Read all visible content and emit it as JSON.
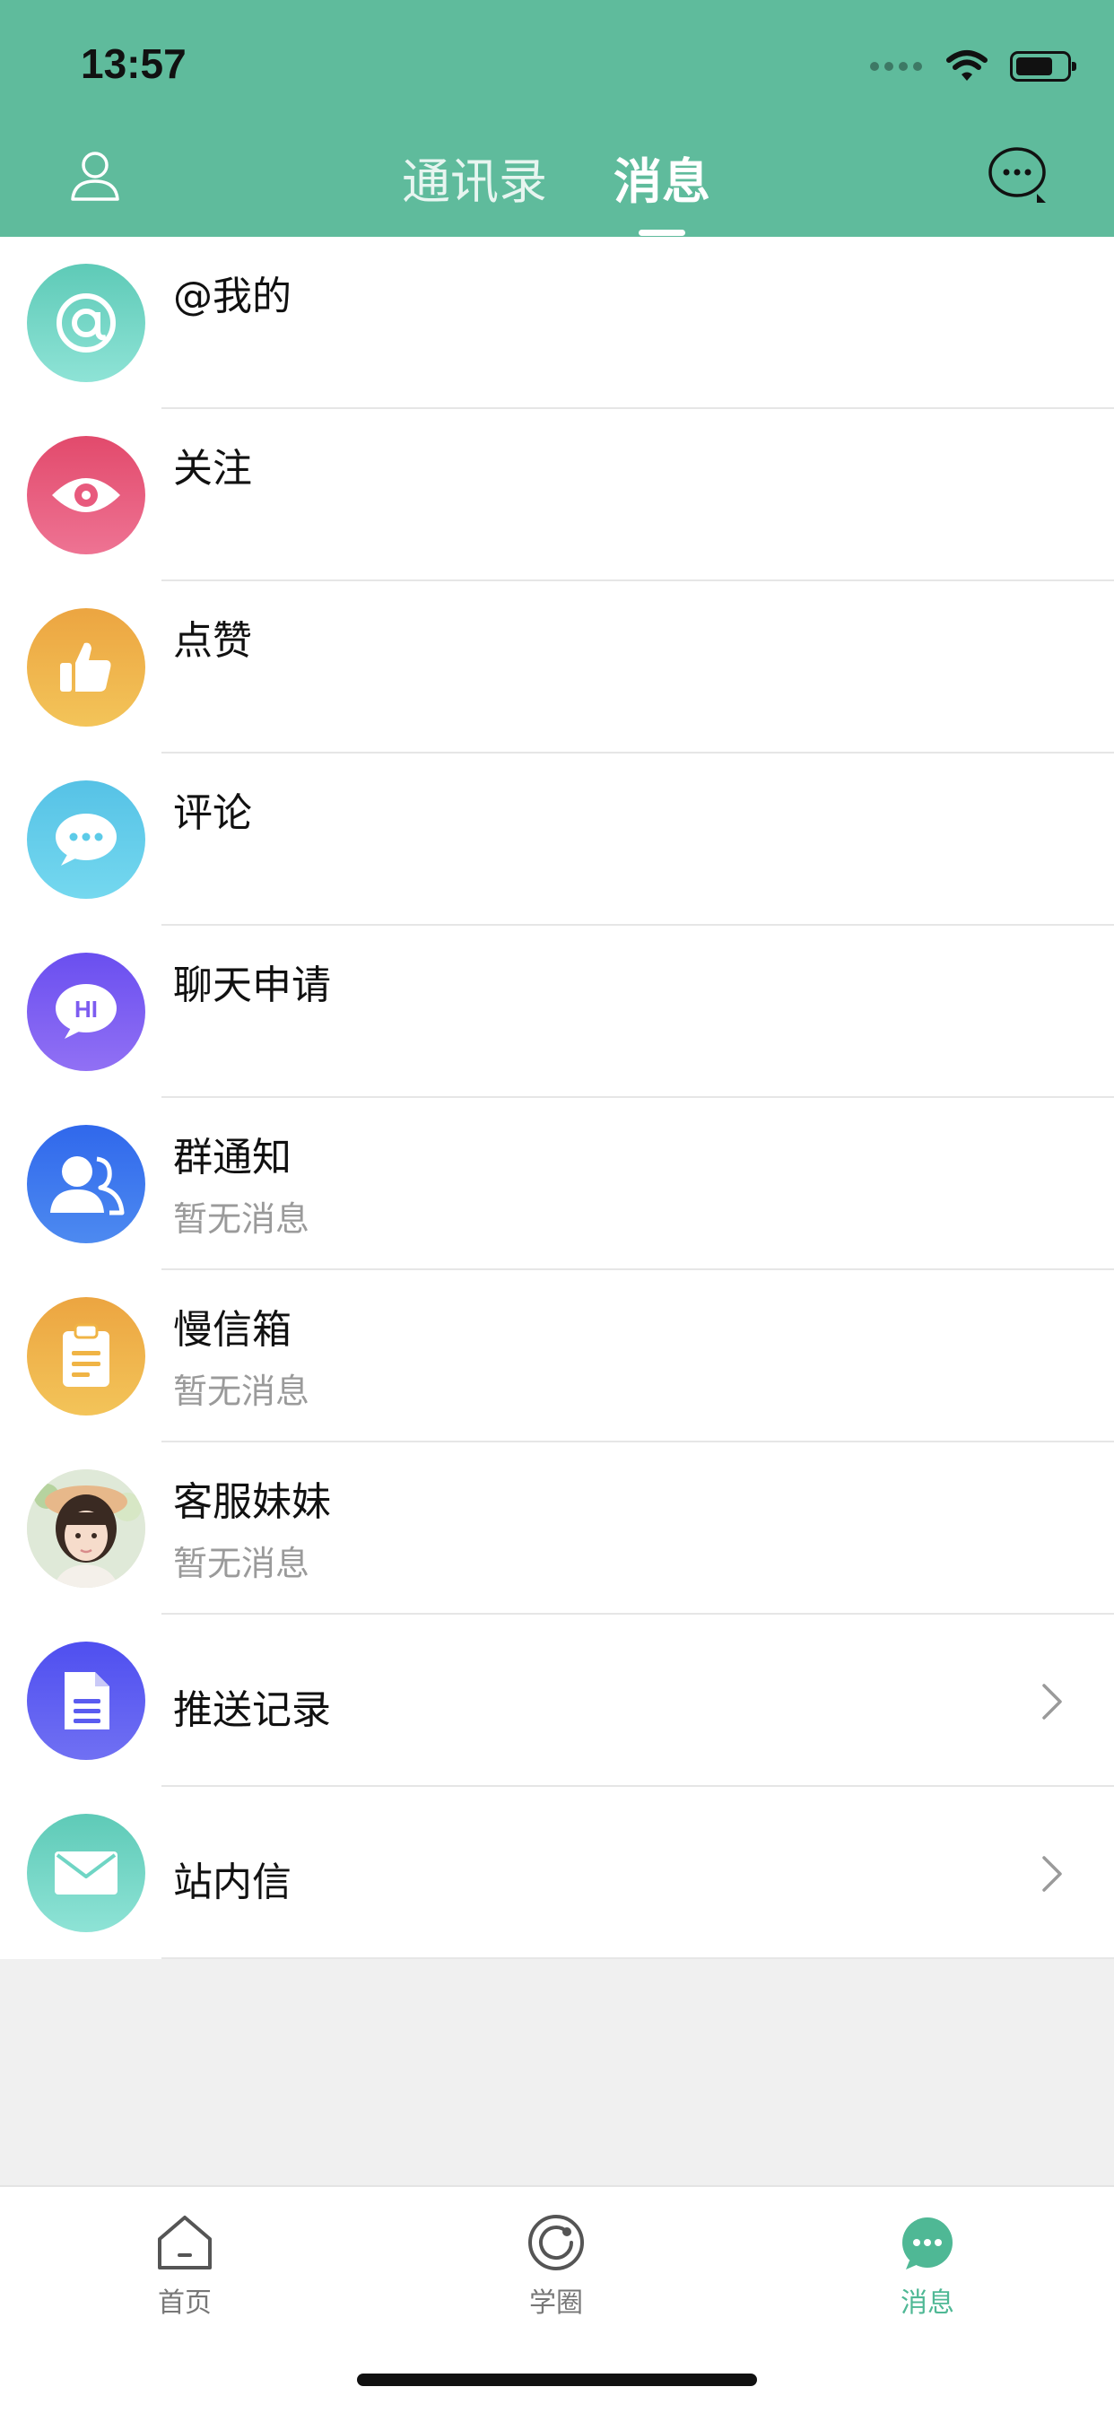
{
  "status_bar": {
    "time": "13:57"
  },
  "header": {
    "tabs": [
      {
        "label": "通讯录",
        "active": false
      },
      {
        "label": "消息",
        "active": true
      }
    ],
    "accent_color": "#5fbb9c"
  },
  "messages": [
    {
      "title": "@我的",
      "subtitle": "",
      "icon": "at-icon",
      "color": "#6fd5c4"
    },
    {
      "title": "关注",
      "subtitle": "",
      "icon": "eye-icon",
      "color": "#e8587a"
    },
    {
      "title": "点赞",
      "subtitle": "",
      "icon": "thumbs-up-icon",
      "color": "#f0b445"
    },
    {
      "title": "评论",
      "subtitle": "",
      "icon": "comment-icon",
      "color": "#5ccbe8"
    },
    {
      "title": "聊天申请",
      "subtitle": "",
      "icon": "hi-bubble-icon",
      "color": "#7d5cf0"
    },
    {
      "title": "群通知",
      "subtitle": "暂无消息",
      "icon": "group-icon",
      "color": "#3c74ee"
    },
    {
      "title": "慢信箱",
      "subtitle": "暂无消息",
      "icon": "clipboard-icon",
      "color": "#f0b445"
    },
    {
      "title": "客服妹妹",
      "subtitle": "暂无消息",
      "icon": "customer-service-avatar",
      "color": "#f3d9c8"
    },
    {
      "title": "推送记录",
      "subtitle": "",
      "icon": "document-icon",
      "color": "#5a5cf0",
      "has_arrow": true
    },
    {
      "title": "站内信",
      "subtitle": "",
      "icon": "mail-icon",
      "color": "#6fd5c4",
      "has_arrow": true
    }
  ],
  "tabbar": {
    "items": [
      {
        "label": "首页",
        "icon": "home-icon",
        "active": false
      },
      {
        "label": "学圈",
        "icon": "circle-icon",
        "active": false
      },
      {
        "label": "消息",
        "icon": "message-icon",
        "active": true
      }
    ],
    "active_color": "#4fb895"
  }
}
